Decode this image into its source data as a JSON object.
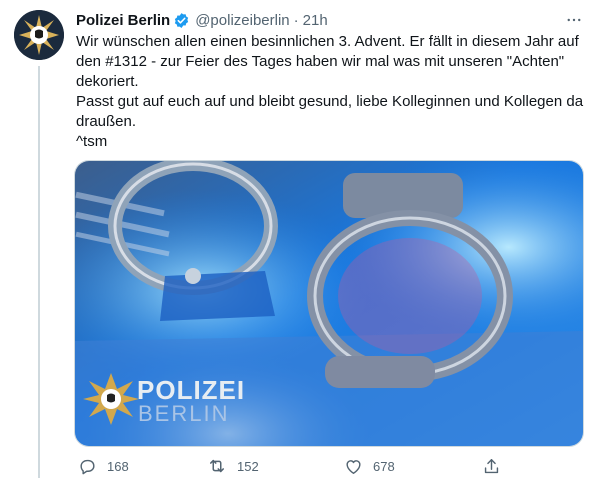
{
  "tweet": {
    "display_name": "Polizei Berlin",
    "handle": "@polizeiberlin",
    "separator": "·",
    "time": "21h",
    "text": "Wir wünschen allen einen besinnlichen 3. Advent. Er fällt in diesem Jahr auf den #1312 - zur Feier des Tages haben wir mal was mit unseren \"Achten\" dekoriert.\nPasst gut auf euch auf und bleibt gesund, liebe Kolleginnen und Kollegen da draußen.\n^tsm"
  },
  "media": {
    "watermark_title": "POLIZEI",
    "watermark_subtitle": "BERLIN"
  },
  "actions": {
    "replies": "168",
    "retweets": "152",
    "likes": "678"
  },
  "icons": {
    "verified": "verified-badge-icon",
    "more": "more-icon",
    "reply": "reply-icon",
    "retweet": "retweet-icon",
    "like": "heart-icon",
    "share": "share-icon"
  },
  "colors": {
    "verified": "#1d9bf0",
    "muted": "#536471",
    "media_blue": "#1a7be0"
  }
}
